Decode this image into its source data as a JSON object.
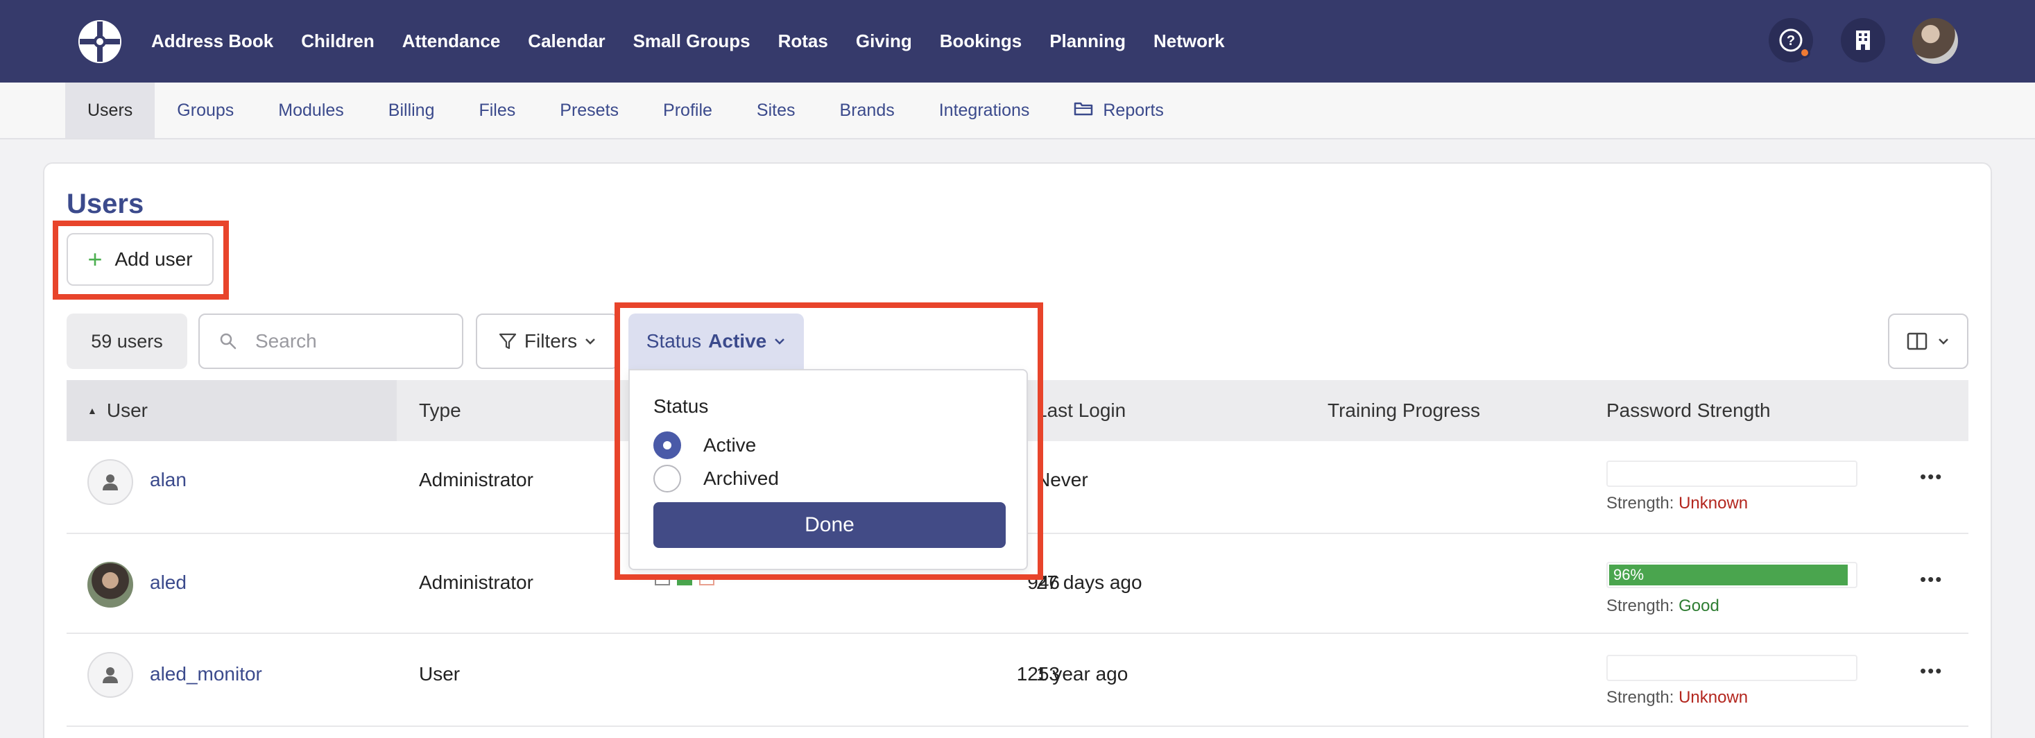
{
  "topnav": {
    "items": [
      "Address Book",
      "Children",
      "Attendance",
      "Calendar",
      "Small Groups",
      "Rotas",
      "Giving",
      "Bookings",
      "Planning",
      "Network"
    ]
  },
  "subnav": {
    "items": [
      "Users",
      "Groups",
      "Modules",
      "Billing",
      "Files",
      "Presets",
      "Profile",
      "Sites",
      "Brands",
      "Integrations",
      "Reports"
    ],
    "active": "Users"
  },
  "page": {
    "title": "Users",
    "add_user_label": "Add user"
  },
  "toolbar": {
    "count": "59 users",
    "search_placeholder": "Search",
    "filters_label": "Filters",
    "status_label": "Status",
    "status_value": "Active"
  },
  "table": {
    "headers": {
      "user": "User",
      "type": "Type",
      "last_login": "Last Login",
      "training": "Training Progress",
      "password": "Password Strength"
    },
    "rows": [
      {
        "user": "alan",
        "type": "Administrator",
        "id": "",
        "last_login": "Never",
        "strength_label": "Strength:",
        "strength": "Unknown",
        "percent_text": "",
        "percent": 0
      },
      {
        "user": "aled",
        "type": "Administrator",
        "id": "946",
        "last_login": "27 days ago",
        "strength_label": "Strength:",
        "strength": "Good",
        "percent_text": "96%",
        "percent": 96
      },
      {
        "user": "aled_monitor",
        "type": "User",
        "id": "1253",
        "last_login": "1 year ago",
        "strength_label": "Strength:",
        "strength": "Unknown",
        "percent_text": "",
        "percent": 0
      }
    ]
  },
  "status_dropdown": {
    "title": "Status",
    "options": [
      "Active",
      "Archived"
    ],
    "selected": "Active",
    "done_label": "Done"
  },
  "colors": {
    "nav_bg": "#363a6b",
    "accent": "#424b86",
    "highlight": "#e8442b",
    "good": "#4aa54e",
    "unknown": "#b3261e"
  }
}
